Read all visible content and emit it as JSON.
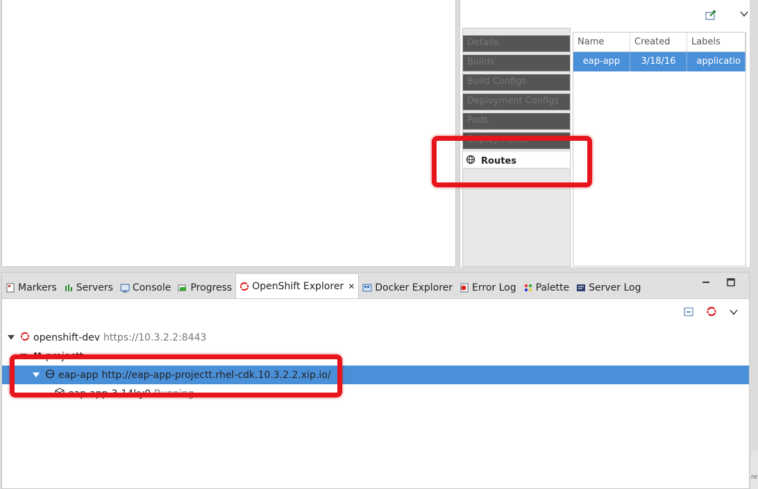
{
  "properties": {
    "tabs": [
      {
        "label": "Details"
      },
      {
        "label": "Builds"
      },
      {
        "label": "Build Configs"
      },
      {
        "label": "Deployment Configs"
      },
      {
        "label": "Pods"
      },
      {
        "label": "Deployments"
      }
    ],
    "active_tab": "Routes",
    "table": {
      "headers": [
        "Name",
        "Created",
        "Labels"
      ],
      "rows": [
        {
          "name": "eap-app",
          "created": "3/18/16",
          "labels": "applicatio"
        }
      ]
    }
  },
  "bottom_tabs": [
    {
      "label": "Markers",
      "icon": "markers-icon"
    },
    {
      "label": "Servers",
      "icon": "servers-icon"
    },
    {
      "label": "Console",
      "icon": "console-icon"
    },
    {
      "label": "Progress",
      "icon": "progress-icon"
    },
    {
      "label": "OpenShift Explorer",
      "icon": "openshift-icon"
    },
    {
      "label": "Docker Explorer",
      "icon": "docker-icon"
    },
    {
      "label": "Error Log",
      "icon": "error-log-icon"
    },
    {
      "label": "Palette",
      "icon": "palette-icon"
    },
    {
      "label": "Server Log",
      "icon": "server-log-icon"
    }
  ],
  "tree": {
    "connection": {
      "name": "openshift-dev",
      "url": "https://10.3.2.2:8443"
    },
    "project": {
      "name": "projectt"
    },
    "route": {
      "name": "eap-app",
      "url": "http://eap-app-projectt.rhel-cdk.10.3.2.2.xip.io/"
    },
    "pod": {
      "name": "eap-app-3-14ky0",
      "status": "Running"
    }
  },
  "edge_text": "re",
  "colors": {
    "selection": "#4a90d9",
    "highlight": "#e8141b",
    "inactive_tab": "#555555"
  }
}
